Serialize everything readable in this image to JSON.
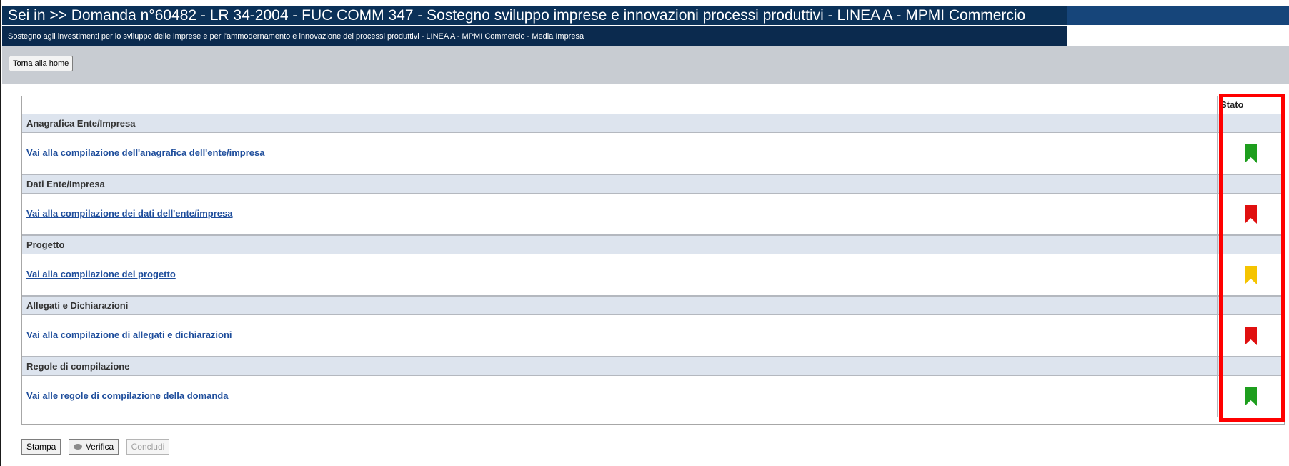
{
  "header": {
    "title": "Sei in >> Domanda n°60482 - LR 34-2004 - FUC  COMM  347 - Sostegno sviluppo imprese e innovazioni processi produttivi - LINEA A - MPMI Commercio",
    "subtitle": "Sostegno agli investimenti per lo sviluppo delle imprese e per l'ammodernamento e innovazione dei processi produttivi - LINEA A - MPMI Commercio - Media Impresa"
  },
  "toolbar": {
    "home_label": "Torna alla home"
  },
  "table": {
    "stato_header": "Stato",
    "sections": [
      {
        "title": "Anagrafica Ente/Impresa",
        "link": "Vai alla compilazione dell'anagrafica dell'ente/impresa",
        "status_color": "#1e9e1e"
      },
      {
        "title": "Dati Ente/Impresa",
        "link": "Vai alla compilazione dei dati dell'ente/impresa",
        "status_color": "#e01010"
      },
      {
        "title": "Progetto",
        "link": "Vai alla compilazione del progetto",
        "status_color": "#f5c400"
      },
      {
        "title": "Allegati e Dichiarazioni",
        "link": "Vai alla compilazione di allegati e dichiarazioni",
        "status_color": "#e01010"
      },
      {
        "title": "Regole di compilazione",
        "link": "Vai alle regole di compilazione della domanda",
        "status_color": "#1e9e1e"
      }
    ]
  },
  "buttons": {
    "stampa": "Stampa",
    "verifica": "Verifica",
    "concludi": "Concludi"
  },
  "colors": {
    "header_bg": "#0b3158",
    "section_bg": "#dde4ee",
    "link": "#1f4e9c",
    "highlight": "#ff0000"
  }
}
